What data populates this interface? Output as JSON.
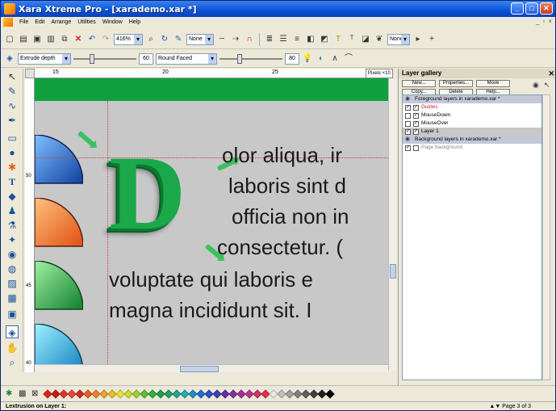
{
  "window": {
    "title": "Xara Xtreme Pro - [xarademo.xar *]",
    "buttons": [
      "_",
      "□",
      "✕"
    ]
  },
  "menu": {
    "items": [
      "File",
      "Edit",
      "Arrange",
      "Utilities",
      "Window",
      "Help"
    ],
    "mdi": [
      "_",
      "▫",
      "×"
    ]
  },
  "toolbar1": {
    "zoom": "416%",
    "line_style": "None",
    "fill_none": "None"
  },
  "toolbar2": {
    "extrude_mode": "Extrude depth",
    "depth_value": "60",
    "bevel_type": "Round Faced",
    "bevel_value": "80"
  },
  "rulers": {
    "top_labels": [
      "15",
      "20",
      "25"
    ],
    "left_labels": [
      "50",
      "45",
      "40"
    ],
    "units": "Pixels ×10"
  },
  "canvas": {
    "dropcap": "D",
    "lines": [
      "olor aliqua, ir",
      "laboris sint d",
      "officia non in",
      "consectetur. (",
      "voluptate qui laboris e",
      "magna incididunt sit. I"
    ]
  },
  "gallery": {
    "title": "Layer gallery",
    "buttons": [
      "New...",
      "Properties...",
      "Move",
      "Copy...",
      "Delete",
      "Help..."
    ],
    "rows": [
      {
        "label": "Foreground layers in xarademo.xar *",
        "type": "group"
      },
      {
        "label": "Guides",
        "type": "layer",
        "style": "red"
      },
      {
        "label": "MouseDown",
        "type": "layer"
      },
      {
        "label": "MouseOver",
        "type": "layer"
      },
      {
        "label": "Layer 1",
        "type": "layer",
        "selected": true
      },
      {
        "label": "Background layers in xarademo.xar *",
        "type": "group"
      },
      {
        "label": "Page background",
        "type": "layer",
        "style": "grey"
      }
    ]
  },
  "palette": {
    "colors": [
      "#e02020",
      "#c81818",
      "#e83030",
      "#f04040",
      "#d02828",
      "#e86020",
      "#f08030",
      "#f0a030",
      "#e8c020",
      "#f0e030",
      "#c8e030",
      "#a0d030",
      "#60c030",
      "#30b040",
      "#20a050",
      "#20a070",
      "#20a890",
      "#20b0b0",
      "#2090c0",
      "#2070d0",
      "#3050c8",
      "#4040b8",
      "#6030b0",
      "#8030a8",
      "#a030a0",
      "#c03090",
      "#d03070",
      "#e03050",
      "#e8e8e8",
      "#c0c0c0",
      "#a0a0a0",
      "#808080",
      "#606060",
      "#404040",
      "#202020",
      "#000000"
    ]
  },
  "status": {
    "message": "Lextrusion on Layer 1:",
    "page": "▲▼ Page 3 of 3"
  }
}
